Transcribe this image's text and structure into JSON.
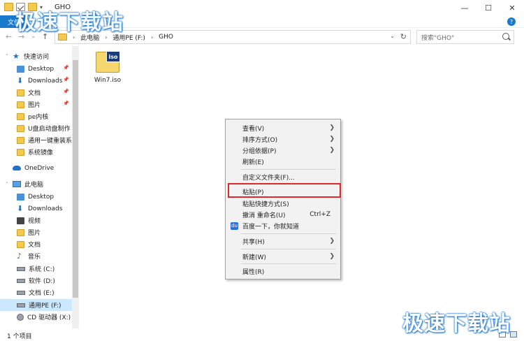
{
  "window": {
    "title": "GHO",
    "minimize": "—",
    "maximize": "☐",
    "close": "✕"
  },
  "ribbon": {
    "file_tab": "文件",
    "help": "?"
  },
  "navigation": {
    "back": "←",
    "forward": "→",
    "recent": "⌄",
    "up": "↑",
    "breadcrumbs": [
      "此电脑",
      "通用PE (F:)",
      "GHO"
    ],
    "search_placeholder": "搜索\"GHO\""
  },
  "sidebar": {
    "items": [
      {
        "label": "快速访问",
        "icon": "star-icon"
      },
      {
        "label": "Desktop",
        "icon": "desktop-folder-icon",
        "pinned": true
      },
      {
        "label": "Downloads",
        "icon": "download-icon",
        "pinned": true
      },
      {
        "label": "文档",
        "icon": "documents-icon",
        "pinned": true
      },
      {
        "label": "图片",
        "icon": "pictures-icon",
        "pinned": true
      },
      {
        "label": "pe内核",
        "icon": "folder-icon"
      },
      {
        "label": "U盘启动盘制作",
        "icon": "folder-icon"
      },
      {
        "label": "通用一键重装系",
        "icon": "folder-icon"
      },
      {
        "label": "系统镜像",
        "icon": "folder-icon"
      },
      {
        "label": "OneDrive",
        "icon": "cloud-icon"
      },
      {
        "label": "此电脑",
        "icon": "computer-icon"
      },
      {
        "label": "Desktop",
        "icon": "desktop-folder-icon"
      },
      {
        "label": "Downloads",
        "icon": "download-icon"
      },
      {
        "label": "视频",
        "icon": "videos-icon"
      },
      {
        "label": "图片",
        "icon": "pictures-icon"
      },
      {
        "label": "文档",
        "icon": "documents-icon"
      },
      {
        "label": "音乐",
        "icon": "music-icon"
      },
      {
        "label": "系统 (C:)",
        "icon": "drive-icon"
      },
      {
        "label": "软件 (D:)",
        "icon": "drive-icon"
      },
      {
        "label": "文档 (E:)",
        "icon": "drive-icon"
      },
      {
        "label": "通用PE (F:)",
        "icon": "drive-icon",
        "selected": true
      },
      {
        "label": "CD 驱动器 (X:)",
        "icon": "cd-drive-icon"
      }
    ]
  },
  "content": {
    "files": [
      {
        "name": "Win7.iso",
        "badge": "iso"
      }
    ]
  },
  "context_menu": {
    "items": [
      {
        "label": "查看(V)",
        "submenu": true
      },
      {
        "label": "排序方式(O)",
        "submenu": true
      },
      {
        "label": "分组依据(P)",
        "submenu": true
      },
      {
        "label": "刷新(E)"
      },
      {
        "label": "自定义文件夹(F)..."
      },
      {
        "label": "粘贴(P)",
        "highlighted": true
      },
      {
        "label": "粘贴快捷方式(S)"
      },
      {
        "label": "撤消 重命名(U)",
        "shortcut": "Ctrl+Z"
      },
      {
        "label": "百度一下，你就知道",
        "icon": "baidu-icon"
      },
      {
        "label": "共享(H)",
        "submenu": true
      },
      {
        "label": "新建(W)",
        "submenu": true
      },
      {
        "label": "属性(R)"
      }
    ],
    "arrow": "❯",
    "highlight_color": "#e0272d"
  },
  "status": {
    "text": "1 个项目"
  },
  "watermark": {
    "text": "极速下载站"
  },
  "colors": {
    "accent": "#1979ca",
    "selected": "#cce8ff",
    "folder": "#f3c94f"
  }
}
